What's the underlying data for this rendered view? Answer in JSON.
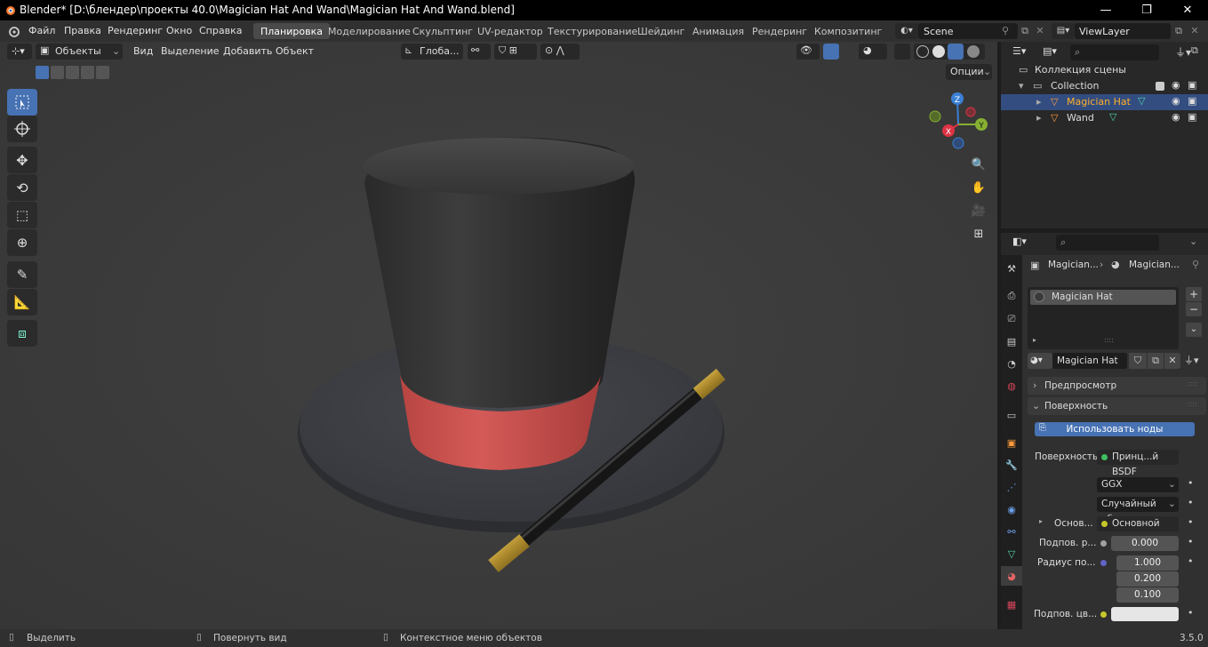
{
  "window": {
    "title": "Blender* [D:\\блендер\\проекты 40.0\\Magician Hat And Wand\\Magician Hat And Wand.blend]"
  },
  "menu": [
    "Файл",
    "Правка",
    "Рендеринг",
    "Окно",
    "Справка"
  ],
  "workspaces": [
    "Планировка",
    "Моделирование",
    "Скульптинг",
    "UV-редактор",
    "Текстурирование",
    "Шейдинг",
    "Анимация",
    "Рендеринг",
    "Композитинг"
  ],
  "scene": {
    "name": "Scene",
    "view_layer": "ViewLayer"
  },
  "viewport_header": {
    "mode": "Объекты",
    "menus": [
      "Вид",
      "Выделение",
      "Добавить",
      "Объект"
    ],
    "transform_orientation": "Глоба...",
    "options": "Опции"
  },
  "gizmo": {
    "x": "X",
    "y": "Y",
    "z": "Z"
  },
  "outliner": {
    "root": "Коллекция сцены",
    "collection": "Collection",
    "objects": [
      {
        "name": "Magician Hat",
        "selected": true
      },
      {
        "name": "Wand",
        "selected": false
      }
    ]
  },
  "properties": {
    "breadcrumb_object": "Magician...",
    "breadcrumb_material": "Magician...",
    "material_slot": "Magician Hat",
    "material_name": "Magician Hat",
    "sections": {
      "preview": "Предпросмотр",
      "surface": "Поверхность"
    },
    "use_nodes_button": "Использовать ноды",
    "surface_label": "Поверхность",
    "surface_value": "Принц...й BSDF",
    "distribution": "GGX",
    "subsurface_method": "Случайный об...",
    "base_color_label": "Основ...",
    "base_color_value": "Основной цвет",
    "subsurface_label": "Подпов. р...",
    "subsurface_value": "0.000",
    "radius_label": "Радиус по...",
    "radius_values": [
      "1.000",
      "0.200",
      "0.100"
    ],
    "subsurface_color_label": "Подпов. цв..."
  },
  "statusbar": {
    "left": "Выделить",
    "middle": "Повернуть вид",
    "right": "Контекстное меню объектов",
    "version": "3.5.0"
  },
  "colors": {
    "accent": "#4772b3",
    "hat_band": "#c9504e",
    "selected_text": "#ffaf29"
  }
}
